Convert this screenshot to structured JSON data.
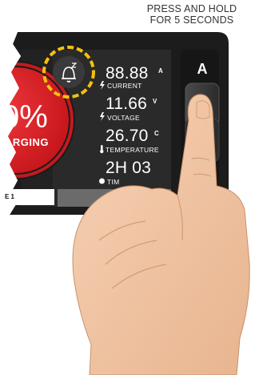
{
  "hint": {
    "line1": "PRESS AND HOLD",
    "line2": "FOR 5 SECONDS"
  },
  "display": {
    "charge_text": "0%",
    "charging_label": "ARGING",
    "current": {
      "value": "88.88",
      "unit": "A",
      "label": "CURRENT"
    },
    "voltage": {
      "value": "11.66",
      "unit": "V",
      "label": "VOLTAGE"
    },
    "temperature": {
      "value": "26.70",
      "unit": "C",
      "label": "TEMPERATURE"
    },
    "time": {
      "value": "2H 03",
      "label": "TIM"
    },
    "tab_label": "E 1"
  },
  "buttons": {
    "a_label": "A"
  },
  "colors": {
    "accent_red": "#e31e24",
    "highlight_yellow": "#f4c20d",
    "panel_dark": "#1a1a1a"
  },
  "icons": {
    "sleep": "sleep-bell-icon"
  }
}
